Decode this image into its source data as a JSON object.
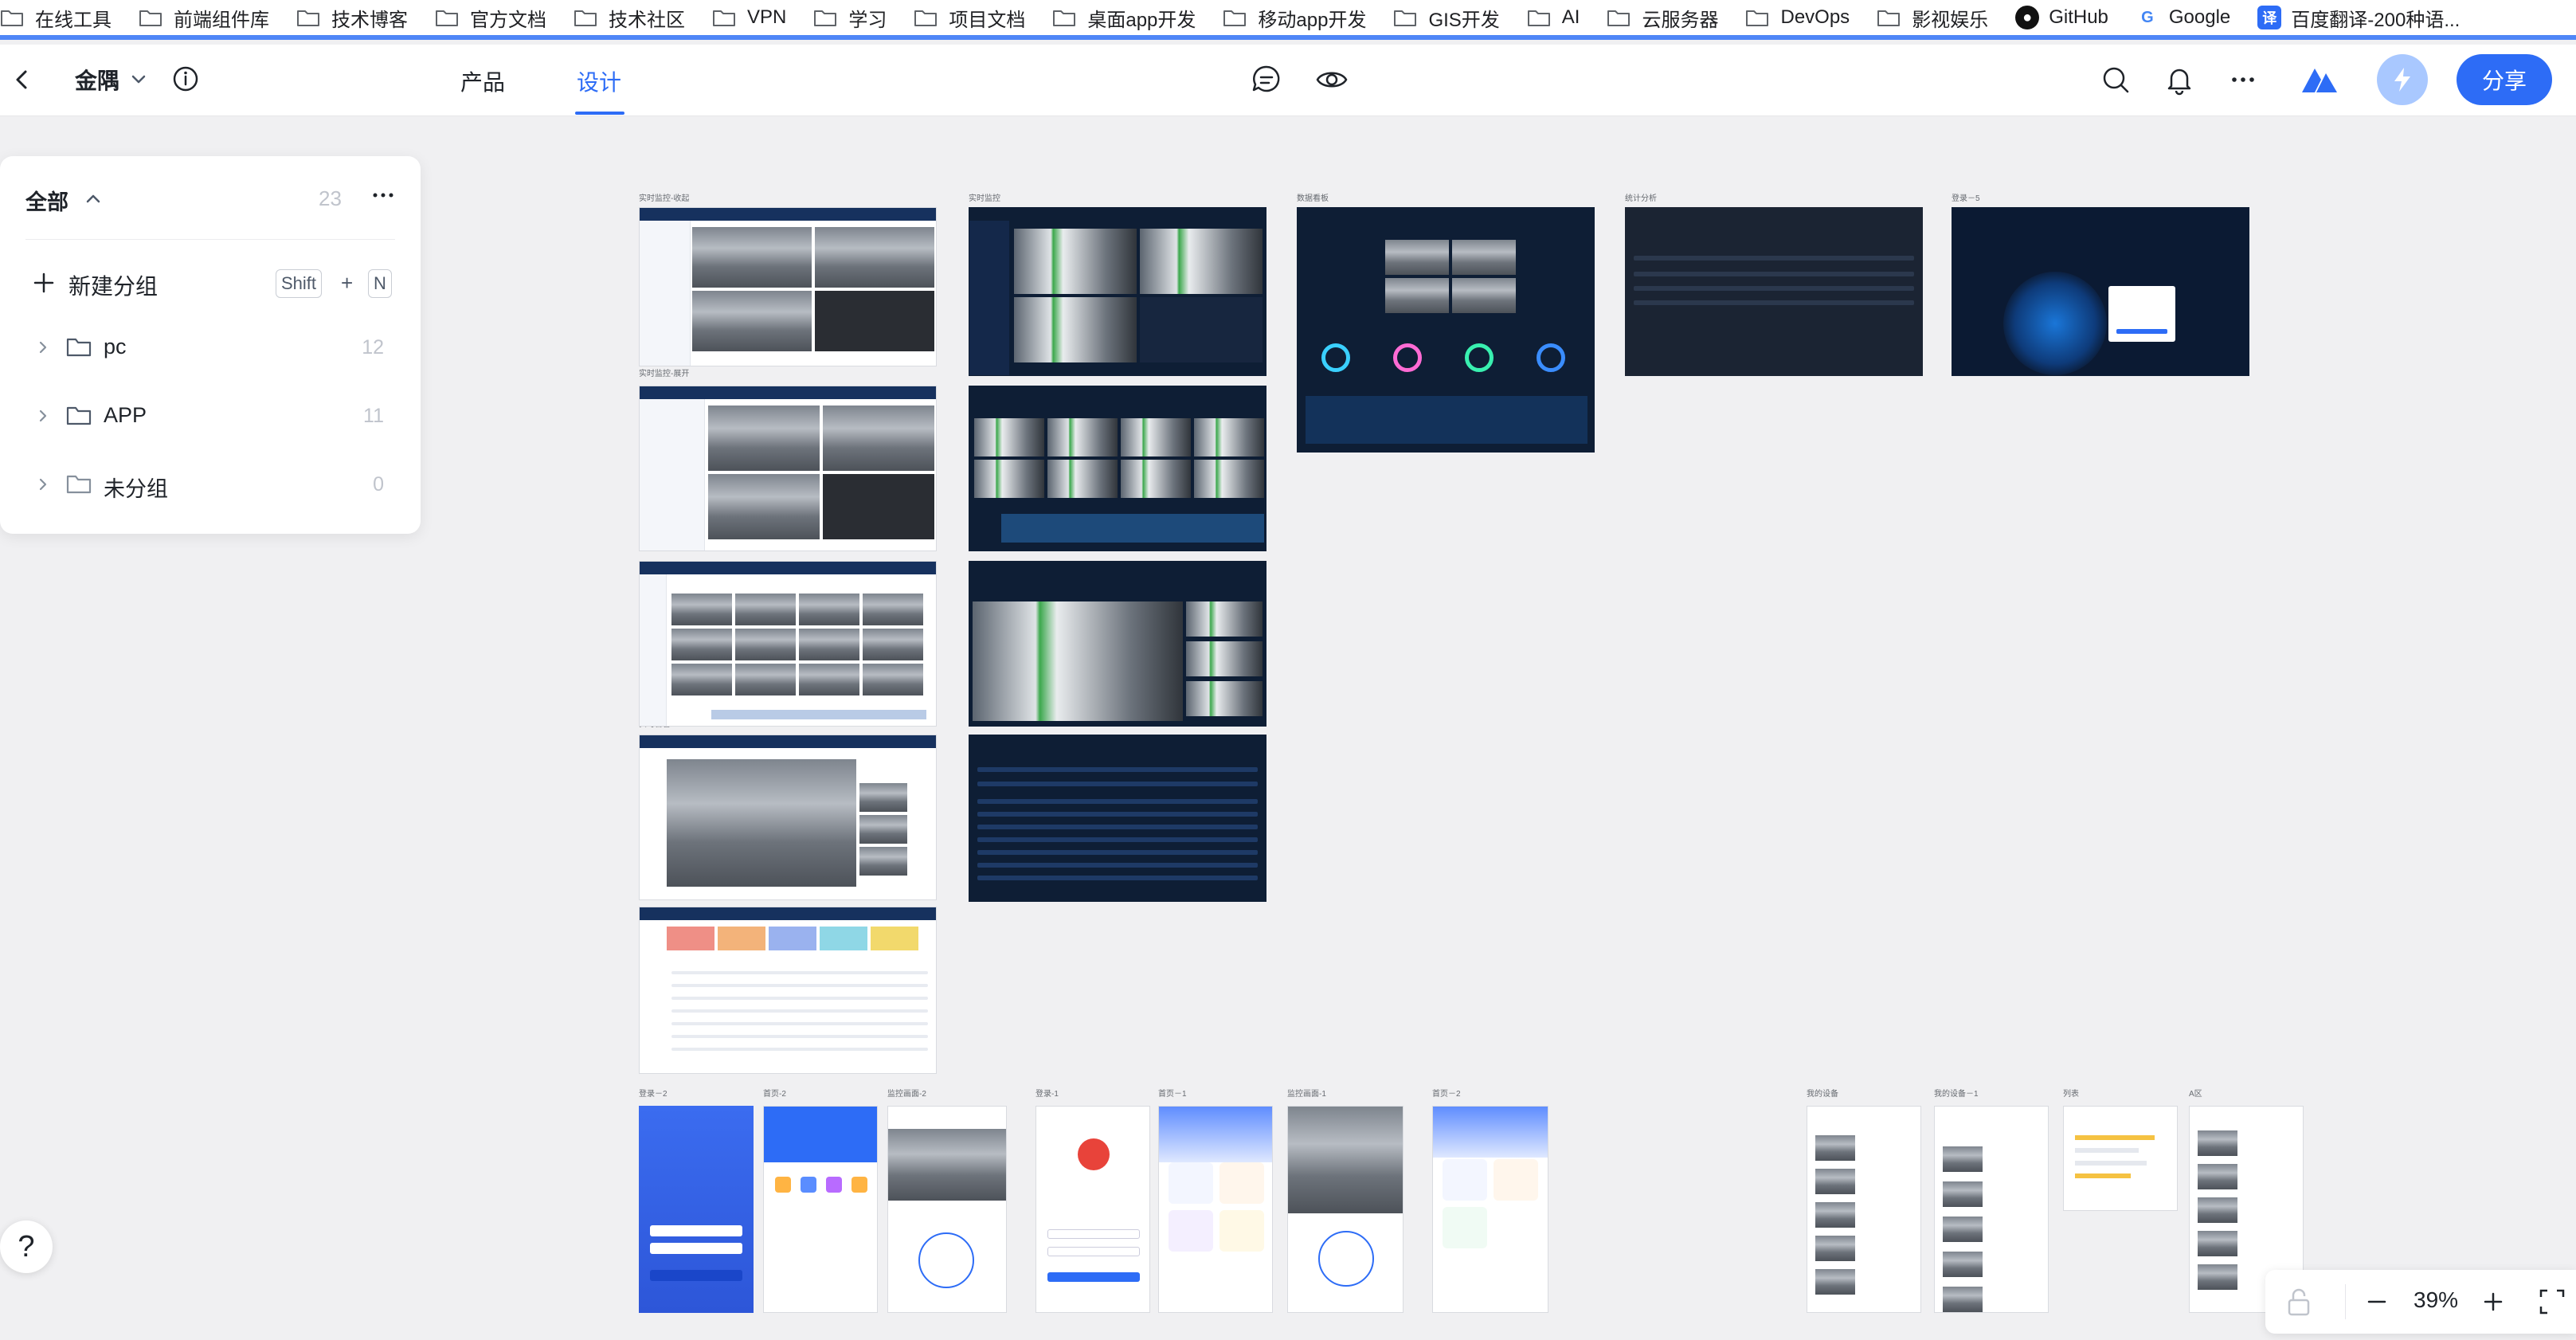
{
  "bookmarks": [
    {
      "label": "在线工具",
      "icon": "folder-icon"
    },
    {
      "label": "前端组件库",
      "icon": "folder-icon"
    },
    {
      "label": "技术博客",
      "icon": "folder-icon"
    },
    {
      "label": "官方文档",
      "icon": "folder-icon"
    },
    {
      "label": "技术社区",
      "icon": "folder-icon"
    },
    {
      "label": "VPN",
      "icon": "folder-icon"
    },
    {
      "label": "学习",
      "icon": "folder-icon"
    },
    {
      "label": "项目文档",
      "icon": "folder-icon"
    },
    {
      "label": "桌面app开发",
      "icon": "folder-icon"
    },
    {
      "label": "移动app开发",
      "icon": "folder-icon"
    },
    {
      "label": "GIS开发",
      "icon": "folder-icon"
    },
    {
      "label": "AI",
      "icon": "folder-icon"
    },
    {
      "label": "云服务器",
      "icon": "folder-icon"
    },
    {
      "label": "DevOps",
      "icon": "folder-icon"
    },
    {
      "label": "影视娱乐",
      "icon": "folder-icon"
    },
    {
      "label": "GitHub",
      "icon": "github-icon"
    },
    {
      "label": "Google",
      "icon": "google-icon"
    },
    {
      "label": "百度翻译-200种语...",
      "icon": "baidu-translate-icon",
      "badge": "译"
    }
  ],
  "header": {
    "project_name": "金隅",
    "tabs": [
      {
        "label": "产品",
        "active": false
      },
      {
        "label": "设计",
        "active": true
      }
    ],
    "share_label": "分享",
    "accent": "#2d6cf6"
  },
  "left_panel": {
    "all_label": "全部",
    "all_count": "23",
    "new_group_label": "新建分组",
    "shortcut": [
      "Shift",
      "+",
      "N"
    ],
    "groups": [
      {
        "name": "pc",
        "count": "12"
      },
      {
        "name": "APP",
        "count": "11"
      },
      {
        "name": "未分组",
        "count": "0"
      }
    ]
  },
  "canvas": {
    "frames": [
      {
        "label": "实时监控-收起"
      },
      {
        "label": "实时监控-展开"
      },
      {
        "label": "实时告警"
      },
      {
        "label": "实时监控"
      },
      {
        "label": "数据看板"
      },
      {
        "label": "统计分析"
      },
      {
        "label": "登录－5"
      },
      {
        "label": "登录－2"
      },
      {
        "label": "首页-2"
      },
      {
        "label": "监控画面-2"
      },
      {
        "label": "登录-1"
      },
      {
        "label": "首页－1"
      },
      {
        "label": "监控画面-1"
      },
      {
        "label": "首页－2"
      },
      {
        "label": "我的设备"
      },
      {
        "label": "我的设备－1"
      },
      {
        "label": "列表"
      },
      {
        "label": "A区"
      }
    ]
  },
  "help_label": "?",
  "zoom": {
    "value": "39%"
  }
}
